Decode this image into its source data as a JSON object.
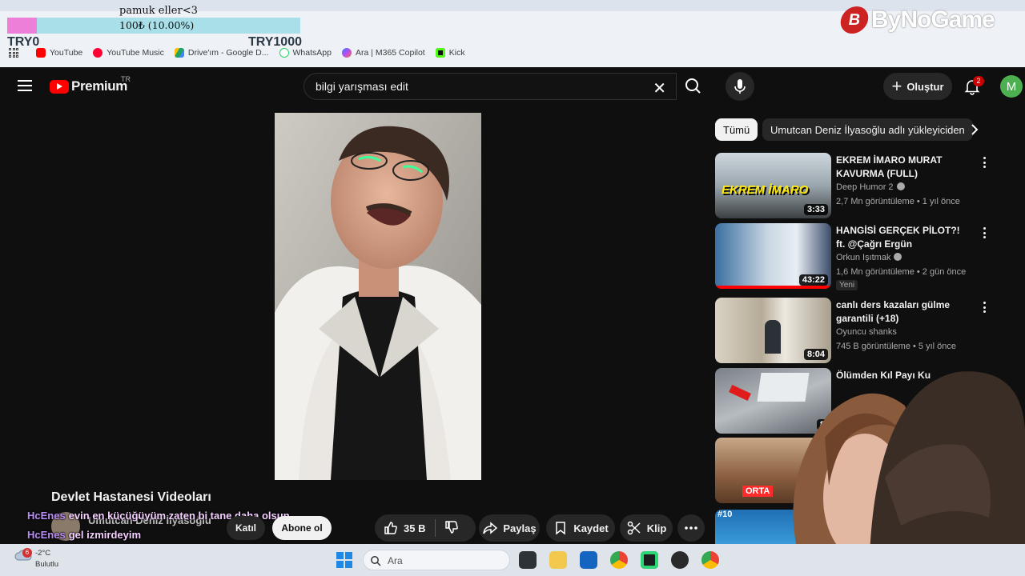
{
  "browser": {
    "address_fragment": "ʃ",
    "bookmarks": [
      {
        "label": "YouTube",
        "icon": "youtube-icon",
        "color": "#ff0000"
      },
      {
        "label": "YouTube Music",
        "icon": "youtube-music-icon",
        "color": "#ff0033"
      },
      {
        "label": "Drive'ım - Google D...",
        "icon": "google-drive-icon",
        "color": "#1fa463"
      },
      {
        "label": "WhatsApp",
        "icon": "whatsapp-icon",
        "color": "#25d366"
      },
      {
        "label": "Ara | M365 Copilot",
        "icon": "copilot-icon",
        "color": "#7b61ff"
      },
      {
        "label": "Kick",
        "icon": "kick-icon",
        "color": "#53fc18"
      }
    ]
  },
  "donation_goal": {
    "name": "pamuk eller<3",
    "progress_text": "100₺ (10.00%)",
    "progress": 0.1,
    "min_label": "TRY0",
    "max_label": "TRY1000",
    "colors": {
      "fill": "#ee7fd8",
      "track": "#a8dfe8"
    }
  },
  "watermark": {
    "logo_letter": "B",
    "text": "ByNoGame"
  },
  "youtube": {
    "logo_text": "Premium",
    "region": "TR",
    "search_query": "bilgi yarışması edit",
    "create_label": "Oluştur",
    "notification_count": "2",
    "avatar_letter": "M",
    "accent": "#ff0000"
  },
  "video": {
    "title": "Devlet Hastanesi Videoları",
    "channel": "Umutcan Deniz İlyasoğlu",
    "join_label": "Katıl",
    "subscribe_label": "Abone ol",
    "likes": "35 B",
    "share_label": "Paylaş",
    "save_label": "Kaydet",
    "clip_label": "Klip"
  },
  "chat": [
    {
      "user": "HcEnes",
      "message": "evin en küçüğüyüm zaten bi tane daha olsun"
    },
    {
      "user": "HcEnes",
      "message": "gel izmirdeyim"
    }
  ],
  "sidebar": {
    "chips": [
      "Tümü",
      "Umutcan Deniz İlyasoğlu adlı yükleyiciden"
    ],
    "recommendations": [
      {
        "title": "EKREM İMARO MURAT KAVURMA (FULL)",
        "channel": "Deep Humor 2",
        "verified": true,
        "meta": "2,7 Mn görüntüleme • 1 yıl önce",
        "duration": "3:33",
        "thumb_text": "EKREM İMARO",
        "badge": ""
      },
      {
        "title": "HANGİSİ GERÇEK PİLOT?! ft. @Çağrı Ergün",
        "channel": "Orkun Işıtmak",
        "verified": true,
        "meta": "1,6 Mn görüntüleme • 2 gün önce",
        "duration": "43:22",
        "thumb_text": "",
        "badge": "Yeni"
      },
      {
        "title": "canlı ders kazaları gülme garantili (+18)",
        "channel": "Oyuncu shanks",
        "verified": false,
        "meta": "745 B görüntüleme • 5 yıl önce",
        "duration": "8:04",
        "thumb_text": "",
        "badge": ""
      },
      {
        "title": "Ölümden Kıl Payı Ku",
        "channel": "",
        "verified": false,
        "meta": "",
        "duration": "8",
        "thumb_text": "",
        "badge": ""
      },
      {
        "title": "",
        "channel": "",
        "verified": false,
        "meta": "",
        "duration": "",
        "thumb_text": "ORTA",
        "badge": ""
      },
      {
        "title": "",
        "channel": "",
        "verified": false,
        "meta": "",
        "duration": "",
        "thumb_text": "#10",
        "badge": ""
      }
    ]
  },
  "taskbar": {
    "weather_temp": "-2°C",
    "weather_desc": "Bulutlu",
    "weather_badge": "6",
    "search_placeholder": "Ara"
  }
}
